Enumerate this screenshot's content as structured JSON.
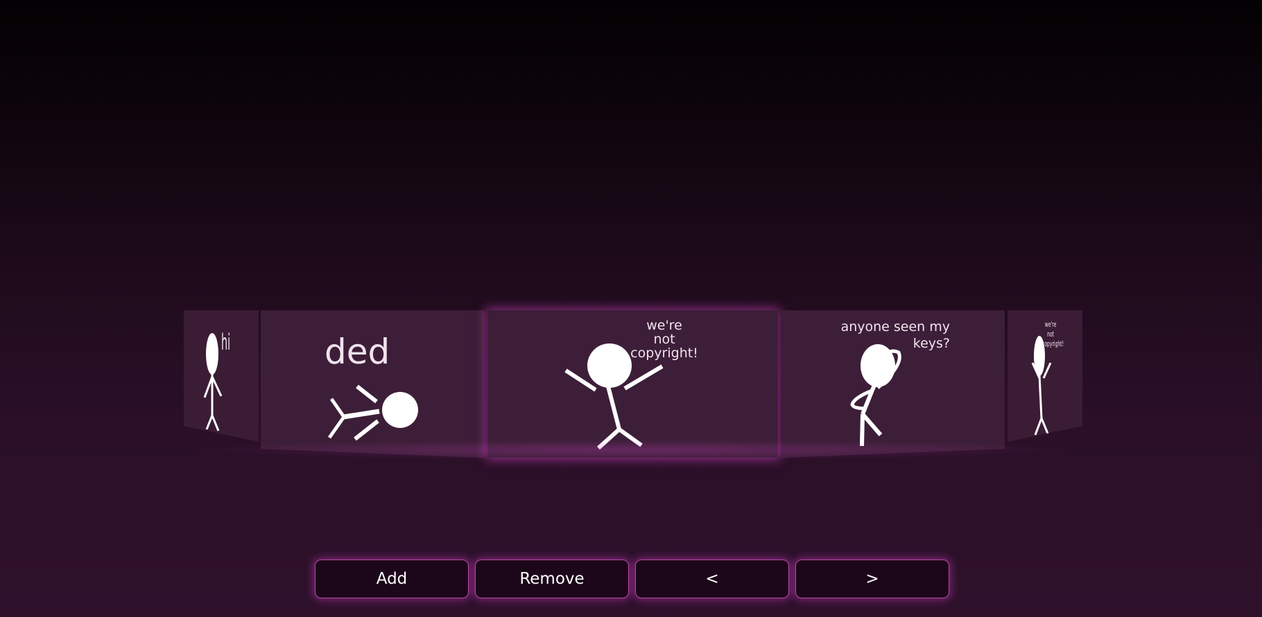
{
  "carousel": {
    "panels": [
      {
        "caption": "hi"
      },
      {
        "caption": "ded"
      },
      {
        "caption": "we're\nnot\ncopyright!"
      },
      {
        "caption": "anyone seen my\nkeys?"
      },
      {
        "caption": "we're\nnot\ncopyright!"
      }
    ]
  },
  "toolbar": {
    "add_label": "Add",
    "remove_label": "Remove",
    "prev_label": "<",
    "next_label": ">"
  },
  "colors": {
    "panel": "#3d1e38",
    "glow": "#d646c8",
    "button_bg": "#1c0619",
    "button_border": "#b24aa6"
  }
}
